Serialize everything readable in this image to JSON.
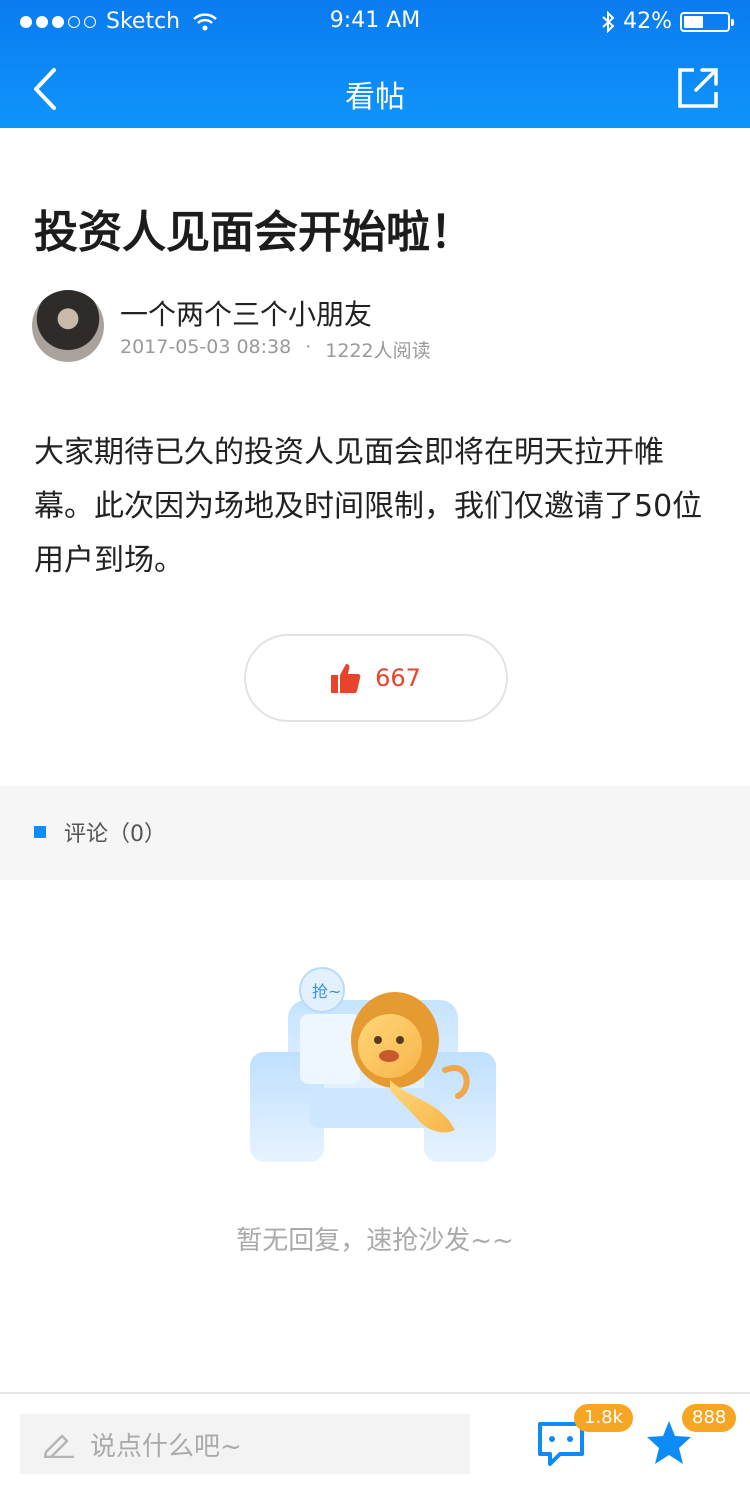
{
  "status_bar": {
    "carrier": "Sketch",
    "time": "9:41 AM",
    "battery": "42%",
    "battery_level": 0.42
  },
  "nav": {
    "title": "看帖"
  },
  "article": {
    "title": "投资人见面会开始啦！",
    "author": "一个两个三个小朋友",
    "date": "2017-05-03 08:38",
    "separator": "·",
    "reads": "1222人阅读",
    "body": "大家期待已久的投资人见面会即将在明天拉开帷幕。此次因为场地及时间限制，我们仅邀请了50位用户到场。"
  },
  "like": {
    "count": "667"
  },
  "comments": {
    "label": "评论（0）",
    "empty_text": "暂无回复，速抢沙发~~",
    "illustration_text": "抢~"
  },
  "bottom_bar": {
    "input_placeholder": "说点什么吧~",
    "chat_badge": "1.8k",
    "star_badge": "888"
  },
  "colors": {
    "header": "#0f95fb",
    "accent": "#0d8cf7",
    "like": "#e8442b",
    "badge": "#f6a623"
  }
}
